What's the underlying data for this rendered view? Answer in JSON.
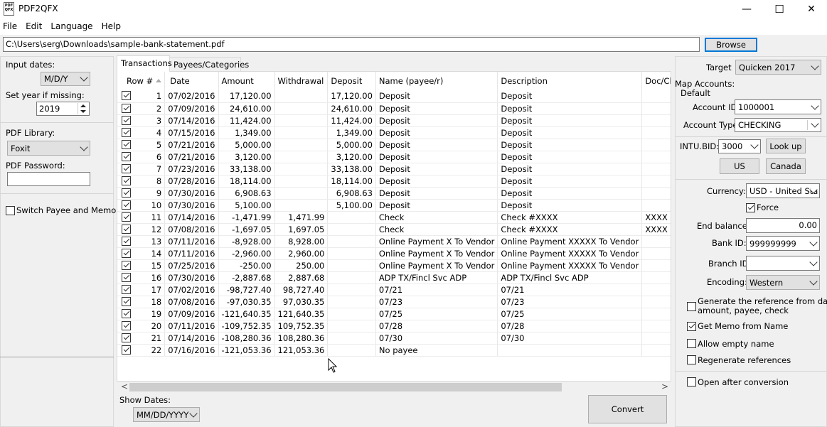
{
  "window": {
    "title": "PDF2QFX",
    "icon_text_top": "PDF",
    "icon_text_bottom": "QFX",
    "minimize_glyph": "—",
    "maximize_glyph": "☐",
    "close_glyph": "✕"
  },
  "menu": [
    "File",
    "Edit",
    "Language",
    "Help"
  ],
  "file": {
    "path": "C:\\Users\\serg\\Downloads\\sample-bank-statement.pdf",
    "browse_label": "Browse"
  },
  "left": {
    "input_dates_label": "Input dates:",
    "input_dates_value": "M/D/Y",
    "set_year_label": "Set year if missing:",
    "set_year_value": "2019",
    "pdf_library_label": "PDF Library:",
    "pdf_library_value": "Foxit",
    "pdf_password_label": "PDF Password:",
    "pdf_password_value": "",
    "switch_label": "Switch Payee and Memo"
  },
  "tabs": [
    "Transactions",
    "Payees/Categories"
  ],
  "table": {
    "columns": [
      "Row #",
      "Date",
      "Amount",
      "Withdrawal",
      "Deposit",
      "Name (payee/r)",
      "Description",
      "Doc/Check #"
    ],
    "rows": [
      [
        "1",
        "07/02/2016",
        "17,120.00",
        "",
        "17,120.00",
        "Deposit",
        "Deposit",
        ""
      ],
      [
        "2",
        "07/09/2016",
        "24,610.00",
        "",
        "24,610.00",
        "Deposit",
        "Deposit",
        ""
      ],
      [
        "3",
        "07/14/2016",
        "11,424.00",
        "",
        "11,424.00",
        "Deposit",
        "Deposit",
        ""
      ],
      [
        "4",
        "07/15/2016",
        "1,349.00",
        "",
        "1,349.00",
        "Deposit",
        "Deposit",
        ""
      ],
      [
        "5",
        "07/21/2016",
        "5,000.00",
        "",
        "5,000.00",
        "Deposit",
        "Deposit",
        ""
      ],
      [
        "6",
        "07/21/2016",
        "3,120.00",
        "",
        "3,120.00",
        "Deposit",
        "Deposit",
        ""
      ],
      [
        "7",
        "07/23/2016",
        "33,138.00",
        "",
        "33,138.00",
        "Deposit",
        "Deposit",
        ""
      ],
      [
        "8",
        "07/28/2016",
        "18,114.00",
        "",
        "18,114.00",
        "Deposit",
        "Deposit",
        ""
      ],
      [
        "9",
        "07/30/2016",
        "6,908.63",
        "",
        "6,908.63",
        "Deposit",
        "Deposit",
        ""
      ],
      [
        "10",
        "07/30/2016",
        "5,100.00",
        "",
        "5,100.00",
        "Deposit",
        "Deposit",
        ""
      ],
      [
        "11",
        "07/14/2016",
        "-1,471.99",
        "1,471.99",
        "",
        "Check",
        "Check #XXXX",
        "XXXX"
      ],
      [
        "12",
        "07/08/2016",
        "-1,697.05",
        "1,697.05",
        "",
        "Check",
        "Check #XXXX",
        "XXXX"
      ],
      [
        "13",
        "07/11/2016",
        "-8,928.00",
        "8,928.00",
        "",
        "Online Payment X To Vendor",
        "Online Payment XXXXX To Vendor",
        ""
      ],
      [
        "14",
        "07/11/2016",
        "-2,960.00",
        "2,960.00",
        "",
        "Online Payment X To Vendor",
        "Online Payment XXXXX To Vendor",
        ""
      ],
      [
        "15",
        "07/25/2016",
        "-250.00",
        "250.00",
        "",
        "Online Payment X To Vendor",
        "Online Payment XXXXX To Vendor",
        ""
      ],
      [
        "16",
        "07/30/2016",
        "-2,887.68",
        "2,887.68",
        "",
        "ADP TX/Fincl Svc ADP",
        "ADP TX/Fincl Svc ADP",
        ""
      ],
      [
        "17",
        "07/02/2016",
        "-98,727.40",
        "98,727.40",
        "",
        "07/21",
        "07/21",
        ""
      ],
      [
        "18",
        "07/08/2016",
        "-97,030.35",
        "97,030.35",
        "",
        "07/23",
        "07/23",
        ""
      ],
      [
        "19",
        "07/09/2016",
        "-121,640.35",
        "121,640.35",
        "",
        "07/25",
        "07/25",
        ""
      ],
      [
        "20",
        "07/11/2016",
        "-109,752.35",
        "109,752.35",
        "",
        "07/28",
        "07/28",
        ""
      ],
      [
        "21",
        "07/14/2016",
        "-108,280.36",
        "108,280.36",
        "",
        "07/30",
        "07/30",
        ""
      ],
      [
        "22",
        "07/16/2016",
        "-121,053.36",
        "121,053.36",
        "",
        "No payee",
        "",
        ""
      ]
    ]
  },
  "bottom": {
    "show_dates_label": "Show Dates:",
    "show_dates_value": "MM/DD/YYYY",
    "convert_label": "Convert",
    "scroll_left": "<",
    "scroll_right": ">"
  },
  "right": {
    "target_label": "Target",
    "target_value": "Quicken 2017",
    "map_accounts_label": "Map Accounts:",
    "default_label": "Default",
    "account_id_label": "Account ID:",
    "account_id_value": "1000001",
    "account_type_label": "Account Type:",
    "account_type_value": "CHECKING",
    "intu_bid_label": "INTU.BID:",
    "intu_bid_value": "3000",
    "lookup_label": "Look up",
    "us_label": "US",
    "canada_label": "Canada",
    "currency_label": "Currency:",
    "currency_value": "USD - United Sta",
    "force_label": "Force",
    "end_balance_label": "End balance:",
    "end_balance_value": "0.00",
    "bank_id_label": "Bank ID:",
    "bank_id_value": "999999999",
    "branch_id_label": "Branch ID",
    "branch_id_value": "",
    "encoding_label": "Encoding:",
    "encoding_value": "Western",
    "gen_ref_label_1": "Generate the reference from date,",
    "gen_ref_label_2": "amount, payee, check",
    "get_memo_label": "Get Memo from Name",
    "allow_empty_label": "Allow empty name",
    "regen_label": "Regenerate references",
    "open_after_label": "Open after conversion"
  }
}
